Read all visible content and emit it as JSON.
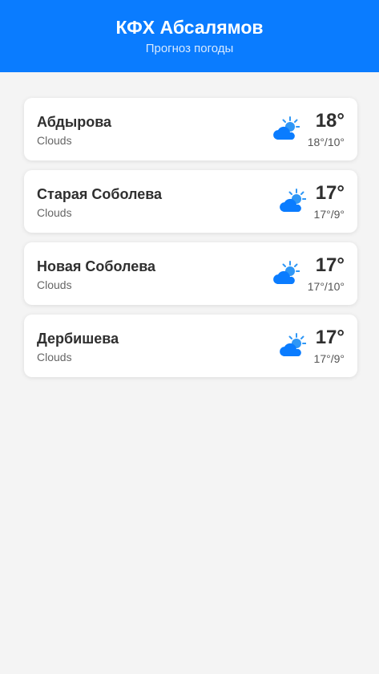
{
  "header": {
    "title": "КФХ Абсалямов",
    "subtitle": "Прогноз погоды"
  },
  "theme": {
    "accent": "#0a7cff",
    "sun": "#2f97f6",
    "cloud": "#0a7cff"
  },
  "locations": [
    {
      "name": "Абдырова",
      "condition": "Clouds",
      "icon": "cloud-sun-icon",
      "temp": "18°",
      "range": "18°/10°"
    },
    {
      "name": "Старая Соболева",
      "condition": "Clouds",
      "icon": "cloud-sun-icon",
      "temp": "17°",
      "range": "17°/9°"
    },
    {
      "name": "Новая Соболева",
      "condition": "Clouds",
      "icon": "cloud-sun-icon",
      "temp": "17°",
      "range": "17°/10°"
    },
    {
      "name": "Дербишева",
      "condition": "Clouds",
      "icon": "cloud-sun-icon",
      "temp": "17°",
      "range": "17°/9°"
    }
  ]
}
